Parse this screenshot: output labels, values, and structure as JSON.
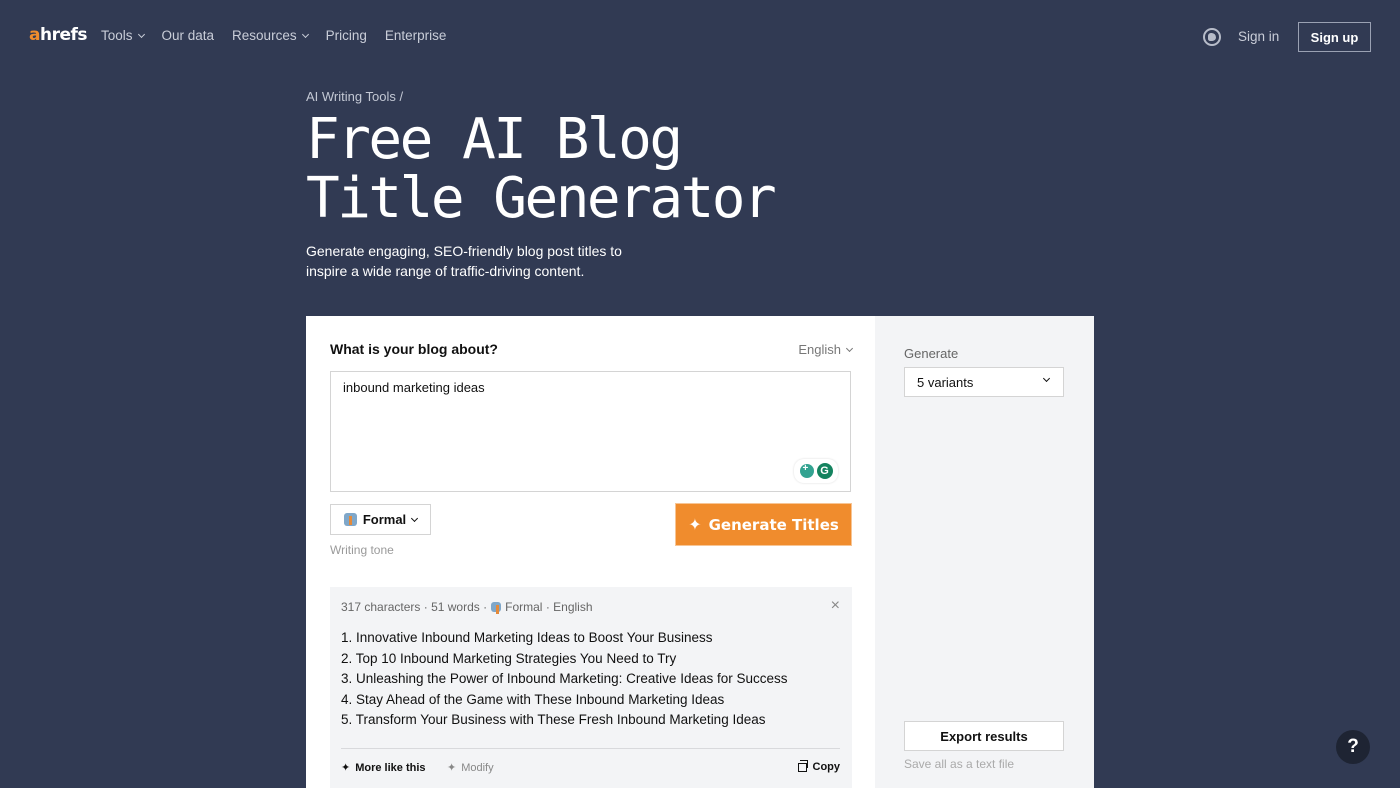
{
  "nav": {
    "logo_a": "a",
    "logo_rest": "hrefs",
    "links": [
      {
        "label": "Tools",
        "dropdown": true
      },
      {
        "label": "Our data",
        "dropdown": false
      },
      {
        "label": "Resources",
        "dropdown": true
      },
      {
        "label": "Pricing",
        "dropdown": false
      },
      {
        "label": "Enterprise",
        "dropdown": false
      }
    ],
    "globe_icon": "globe-icon",
    "sign_in": "Sign in",
    "sign_up": "Sign up"
  },
  "hero": {
    "breadcrumb": "AI Writing Tools",
    "breadcrumb_sep": " /",
    "title": "Free AI Blog Title Generator",
    "subtitle": "Generate engaging, SEO-friendly blog post titles to inspire a wide range of traffic-driving content."
  },
  "form": {
    "question": "What is your blog about?",
    "language": "English",
    "input_value": "inbound marketing ideas",
    "grammarly_icon": "G",
    "tone_value": "Formal",
    "tone_label": "Writing tone",
    "generate_button": "Generate Titles",
    "accent_color": "#f08c2d"
  },
  "results": {
    "meta_chars": "317 characters",
    "meta_words": "51 words",
    "meta_tone": "Formal",
    "meta_lang": "English",
    "sep": "·",
    "close": "×",
    "items": [
      "1. Innovative Inbound Marketing Ideas to Boost Your Business",
      "2. Top 10 Inbound Marketing Strategies You Need to Try",
      "3. Unleashing the Power of Inbound Marketing: Creative Ideas for Success",
      "4. Stay Ahead of the Game with These Inbound Marketing Ideas",
      "5. Transform Your Business with These Fresh Inbound Marketing Ideas"
    ],
    "more_like_this": "More like this",
    "modify": "Modify",
    "copy": "Copy"
  },
  "sidebar": {
    "generate_label": "Generate",
    "variants_value": "5 variants",
    "export_button": "Export results",
    "export_note": "Save all as a text file"
  },
  "help": "?"
}
